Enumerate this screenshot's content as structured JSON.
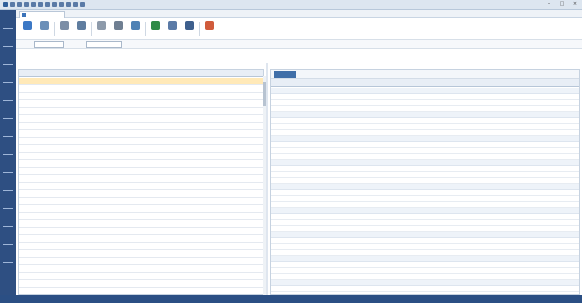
{
  "window": {
    "title": "",
    "min": "–",
    "max": "□",
    "close": "×"
  },
  "tab": {
    "label": ""
  },
  "toolbar": [
    {
      "name": "search",
      "label": "",
      "color": "#3b78c5"
    },
    {
      "name": "new",
      "label": "",
      "color": "#6b8fb8"
    },
    {
      "name": "edit",
      "label": "",
      "color": "#7c8ea6"
    },
    {
      "name": "undo",
      "label": "",
      "color": "#5f7d9f"
    },
    {
      "name": "delete",
      "label": "",
      "color": "#8d9aaa"
    },
    {
      "name": "print",
      "label": "",
      "color": "#6f7f92"
    },
    {
      "name": "preview",
      "label": "",
      "color": "#4f82b5"
    },
    {
      "name": "export",
      "label": "",
      "color": "#2f8a47"
    },
    {
      "name": "settings",
      "label": "",
      "color": "#5a7aa6"
    },
    {
      "name": "tools",
      "label": "",
      "color": "#3e5f8d"
    },
    {
      "name": "close",
      "label": "",
      "color": "#d05b3b"
    }
  ],
  "filter": {
    "label1": "",
    "value1": "",
    "label2": "",
    "value2": ""
  },
  "left": {
    "title": "",
    "headers": [
      "",
      "",
      "",
      "",
      "",
      "",
      "",
      "",
      ""
    ],
    "rows_count": 29,
    "selected_row": 0
  },
  "right": {
    "title": "",
    "selector": "",
    "headers": [
      "",
      "",
      "",
      "",
      "",
      "",
      "",
      "",
      ""
    ],
    "groups": 13
  },
  "status": {
    "user": "",
    "info": "",
    "time": ""
  },
  "colors": {
    "nav": "#2e4f82",
    "selected_row": "#ffe9b8",
    "status": "#2b4f84"
  }
}
